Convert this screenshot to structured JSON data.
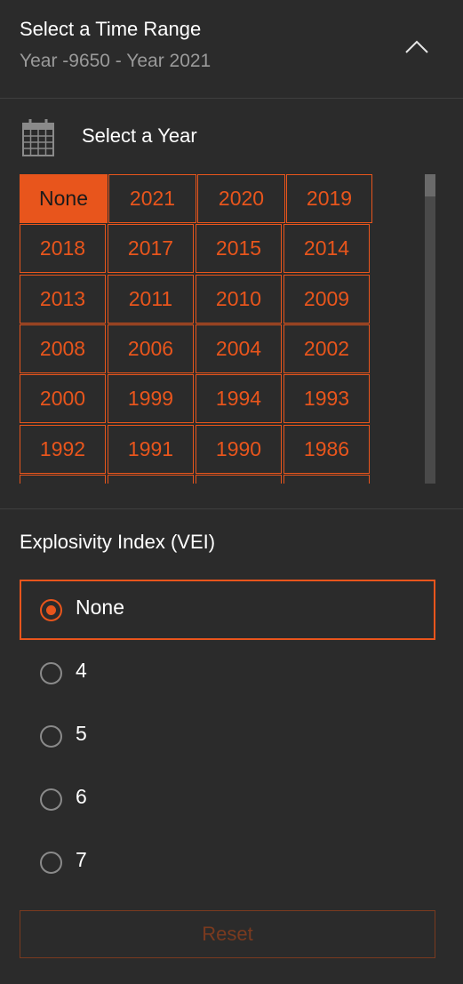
{
  "header": {
    "title": "Select a Time Range",
    "subtitle": "Year -9650 - Year 2021"
  },
  "year_section": {
    "label": "Select a Year",
    "rows": [
      [
        "None",
        "2021",
        "2020",
        "2019"
      ],
      [
        "2018",
        "2017",
        "2015",
        "2014"
      ],
      [
        "2013",
        "2011",
        "2010",
        "2009"
      ],
      [
        "2008",
        "2006",
        "2004",
        "2002"
      ],
      [
        "2000",
        "1999",
        "1994",
        "1993"
      ],
      [
        "1992",
        "1991",
        "1990",
        "1986"
      ]
    ],
    "selected": "None"
  },
  "vei": {
    "title": "Explosivity Index (VEI)",
    "options": [
      "None",
      "4",
      "5",
      "6",
      "7"
    ],
    "selected": "None"
  },
  "reset_label": "Reset",
  "colors": {
    "background": "#2b2b2b",
    "accent": "#e8551c",
    "muted_text": "#9a9a9a"
  },
  "icons": {
    "collapse": "chevron-up-icon",
    "calendar": "calendar-icon"
  }
}
